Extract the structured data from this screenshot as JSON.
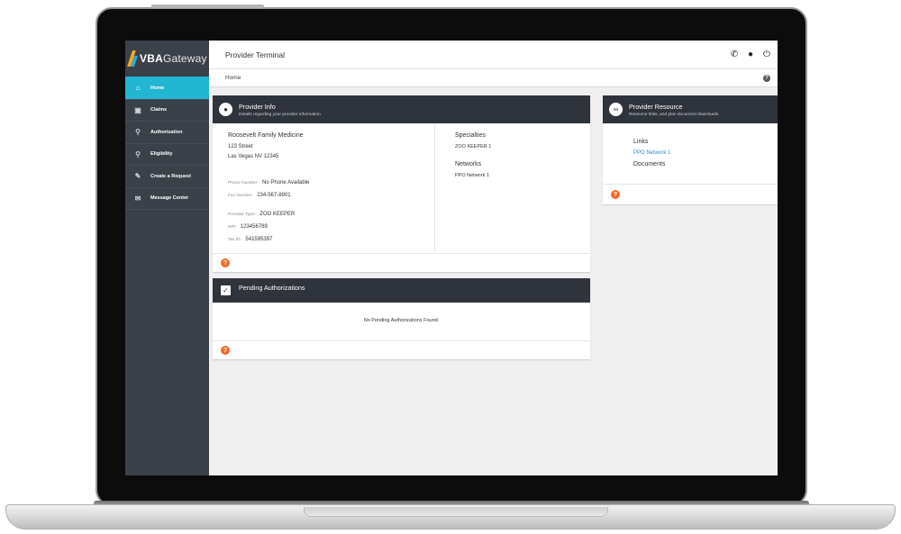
{
  "app": {
    "logo_vba": "VBA",
    "logo_gateway": "Gateway",
    "title": "Provider Terminal"
  },
  "header_icons": [
    "phone-icon",
    "user-icon",
    "power-icon"
  ],
  "breadcrumb": "Home",
  "sidebar": {
    "items": [
      {
        "label": "Home",
        "icon": "home-icon",
        "active": true
      },
      {
        "label": "Claims",
        "icon": "briefcase-icon"
      },
      {
        "label": "Authorization",
        "icon": "key-icon"
      },
      {
        "label": "Eligibility",
        "icon": "search-icon"
      },
      {
        "label": "Create a Request",
        "icon": "edit-icon"
      },
      {
        "label": "Message Center",
        "icon": "envelope-icon"
      }
    ]
  },
  "provider_info": {
    "title": "Provider Info",
    "subtitle": "Details regarding your provider information.",
    "name": "Roosevelt Family Medicine",
    "street": "123 Street",
    "city_line": "Las Vegas NV 12345",
    "phone_label": "Phone Number:",
    "phone_value": "No Phone Available",
    "fax_label": "Fax Number:",
    "fax_value": "234-567-8901",
    "type_label": "Provider Type:",
    "type_value": "ZOO KEEPER",
    "npi_label": "NPI:",
    "npi_value": "123456789",
    "tax_label": "Tax ID:",
    "tax_value": "541595397",
    "specialties_heading": "Specialties",
    "specialty": "ZOO KEEPER 1",
    "networks_heading": "Networks",
    "network": "PPO Network 1"
  },
  "pending_auth": {
    "title": "Pending Authorizations",
    "empty_message": "No Pending Authorizations Found."
  },
  "provider_resource": {
    "title": "Provider Resource",
    "subtitle": "Resource links, and plan document downloads.",
    "links_heading": "Links",
    "link": "PPO Network 1",
    "documents_heading": "Documents"
  },
  "colors": {
    "accent": "#22b6d3",
    "sidebar": "#3b4149",
    "card_header": "#2f333b",
    "help": "#f26a2b",
    "link": "#2d8ac6"
  }
}
